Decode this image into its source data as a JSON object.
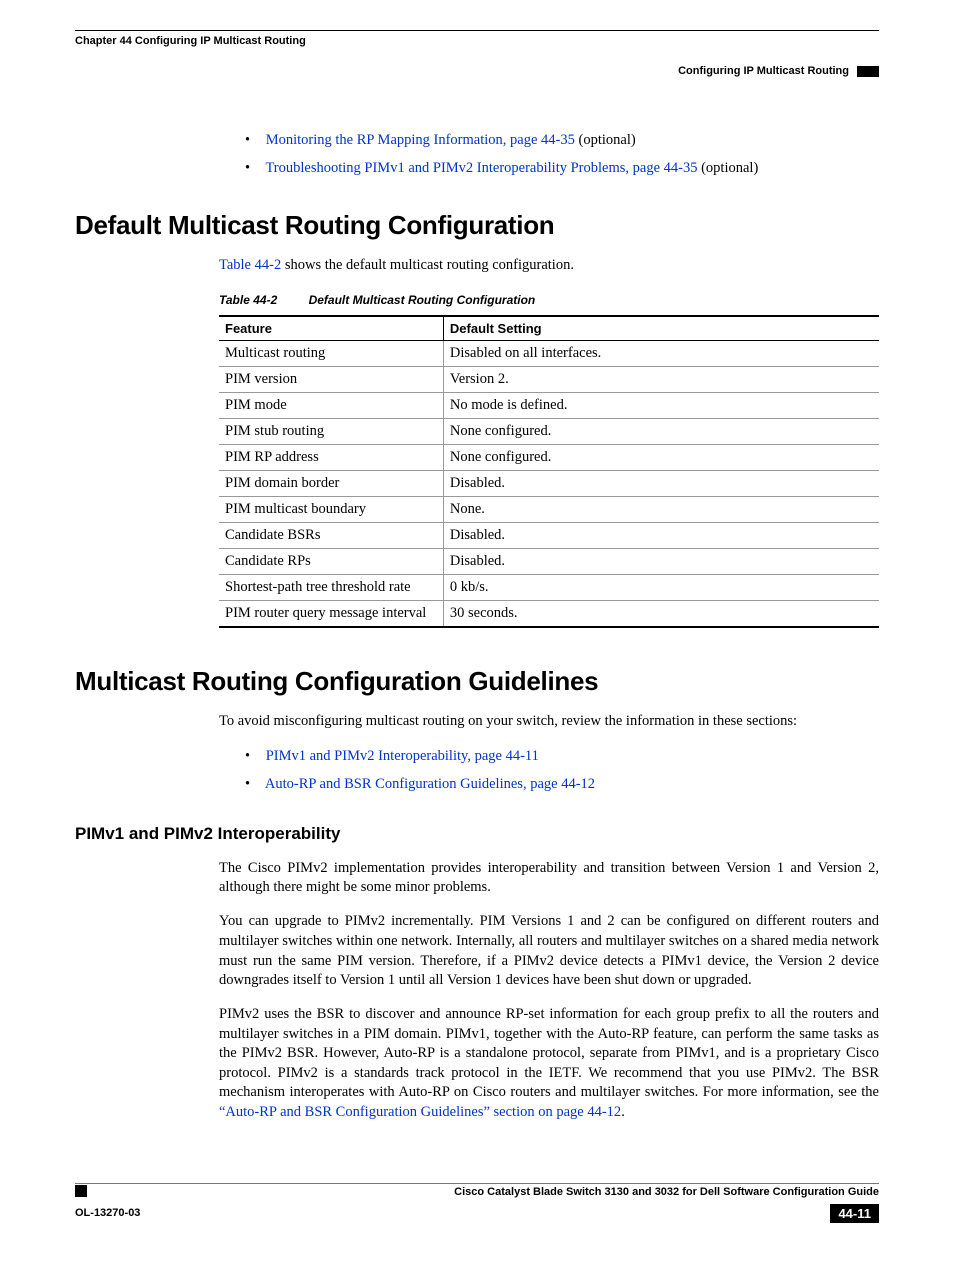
{
  "header": {
    "chapter": "Chapter 44      Configuring IP Multicast Routing",
    "subtitle": "Configuring IP Multicast Routing"
  },
  "top_bullets": [
    {
      "link": "Monitoring the RP Mapping Information, page 44-35",
      "suffix": " (optional)"
    },
    {
      "link": "Troubleshooting PIMv1 and PIMv2 Interoperability Problems, page 44-35",
      "suffix": " (optional)"
    }
  ],
  "section1": {
    "title": "Default Multicast Routing Configuration",
    "intro_link": "Table 44-2",
    "intro_suffix": " shows the default multicast routing configuration.",
    "table_caption_num": "Table 44-2",
    "table_caption_title": "Default Multicast Routing Configuration",
    "table": {
      "headers": [
        "Feature",
        "Default Setting"
      ],
      "rows": [
        [
          "Multicast routing",
          "Disabled on all interfaces."
        ],
        [
          "PIM version",
          "Version 2."
        ],
        [
          "PIM mode",
          "No mode is defined."
        ],
        [
          "PIM stub routing",
          "None configured."
        ],
        [
          "PIM RP address",
          "None configured."
        ],
        [
          "PIM domain border",
          "Disabled."
        ],
        [
          "PIM multicast boundary",
          "None."
        ],
        [
          "Candidate BSRs",
          "Disabled."
        ],
        [
          "Candidate RPs",
          "Disabled."
        ],
        [
          "Shortest-path tree threshold rate",
          "0 kb/s."
        ],
        [
          "PIM router query message interval",
          "30 seconds."
        ]
      ]
    }
  },
  "section2": {
    "title": "Multicast Routing Configuration Guidelines",
    "intro": "To avoid misconfiguring multicast routing on your switch, review the information in these sections:",
    "bullets": [
      {
        "link": "PIMv1 and PIMv2 Interoperability, page 44-11"
      },
      {
        "link": "Auto-RP and BSR Configuration Guidelines, page 44-12"
      }
    ],
    "sub": {
      "title": "PIMv1 and PIMv2 Interoperability",
      "p1": "The Cisco PIMv2 implementation provides interoperability and transition between Version 1 and Version 2, although there might be some minor problems.",
      "p2": "You can upgrade to PIMv2 incrementally. PIM Versions 1 and 2 can be configured on different routers and multilayer switches within one network. Internally, all routers and multilayer switches on a shared media network must run the same PIM version. Therefore, if a PIMv2 device detects a PIMv1 device, the Version 2 device downgrades itself to Version 1 until all Version 1 devices have been shut down or upgraded.",
      "p3_prefix": "PIMv2 uses the BSR to discover and announce RP-set information for each group prefix to all the routers and multilayer switches in a PIM domain. PIMv1, together with the Auto-RP feature, can perform the same tasks as the PIMv2 BSR. However, Auto-RP is a standalone protocol, separate from PIMv1, and is a proprietary Cisco protocol. PIMv2 is a standards track protocol in the IETF. We recommend that you use PIMv2. The BSR mechanism interoperates with Auto-RP on Cisco routers and multilayer switches. For more information, see the ",
      "p3_link": "“Auto-RP and BSR Configuration Guidelines” section on page 44-12",
      "p3_suffix": "."
    }
  },
  "footer": {
    "guide_title": "Cisco Catalyst Blade Switch 3130 and 3032 for Dell Software Configuration Guide",
    "doc_number": "OL-13270-03",
    "page_number": "44-11"
  },
  "chart_data": {
    "type": "table",
    "title": "Default Multicast Routing Configuration",
    "columns": [
      "Feature",
      "Default Setting"
    ],
    "rows": [
      [
        "Multicast routing",
        "Disabled on all interfaces."
      ],
      [
        "PIM version",
        "Version 2."
      ],
      [
        "PIM mode",
        "No mode is defined."
      ],
      [
        "PIM stub routing",
        "None configured."
      ],
      [
        "PIM RP address",
        "None configured."
      ],
      [
        "PIM domain border",
        "Disabled."
      ],
      [
        "PIM multicast boundary",
        "None."
      ],
      [
        "Candidate BSRs",
        "Disabled."
      ],
      [
        "Candidate RPs",
        "Disabled."
      ],
      [
        "Shortest-path tree threshold rate",
        "0 kb/s."
      ],
      [
        "PIM router query message interval",
        "30 seconds."
      ]
    ]
  }
}
